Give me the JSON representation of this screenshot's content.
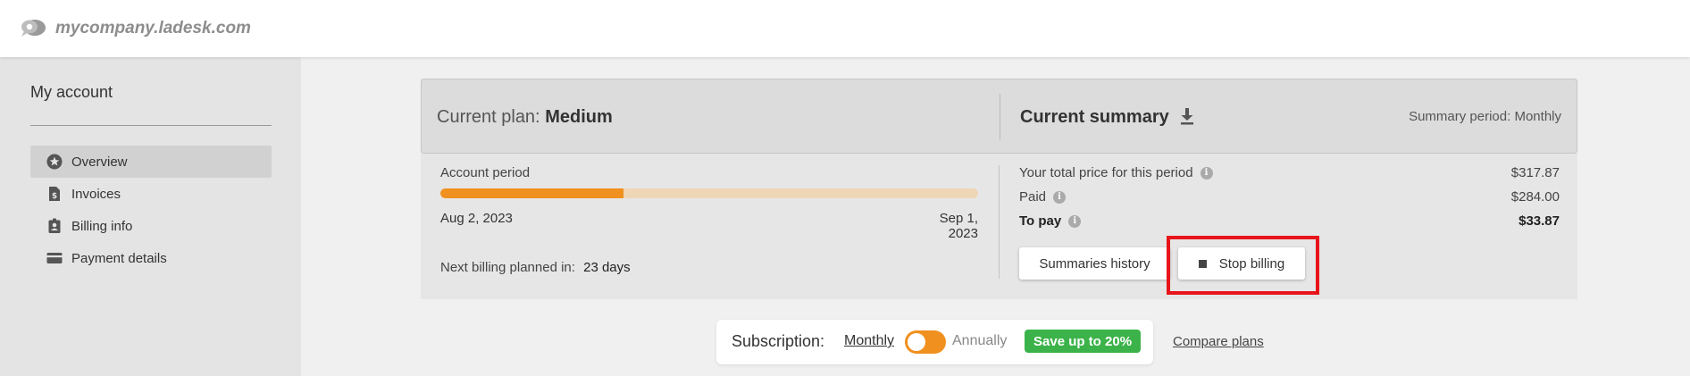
{
  "header": {
    "domain": "mycompany.ladesk.com"
  },
  "sidebar": {
    "title": "My account",
    "items": [
      {
        "label": "Overview",
        "icon": "star-badge-icon",
        "active": true
      },
      {
        "label": "Invoices",
        "icon": "invoice-dollar-icon",
        "active": false
      },
      {
        "label": "Billing info",
        "icon": "id-badge-icon",
        "active": false
      },
      {
        "label": "Payment details",
        "icon": "credit-card-icon",
        "active": false
      }
    ]
  },
  "plan": {
    "label": "Current plan:",
    "name": "Medium"
  },
  "summary": {
    "title": "Current summary",
    "period_label": "Summary period:",
    "period_value": "Monthly",
    "rows": [
      {
        "label": "Your total price for this period",
        "value": "$317.87"
      },
      {
        "label": "Paid",
        "value": "$284.00"
      },
      {
        "label": "To pay",
        "value": "$33.87"
      }
    ],
    "history_button": "Summaries history",
    "stop_button": "Stop billing"
  },
  "account": {
    "period_label": "Account period",
    "progress": 0.34,
    "start_date": "Aug 2, 2023",
    "end_date": "Sep 1, 2023",
    "next_billing_label": "Next billing planned in:",
    "next_billing_value": "23 days"
  },
  "subscription": {
    "label": "Subscription:",
    "monthly": "Monthly",
    "annually": "Annually",
    "save_badge": "Save up to 20%",
    "compare_link": "Compare plans"
  },
  "colors": {
    "accent": "#f0901e",
    "save_green": "#3cb34a",
    "highlight": "#e8141b"
  }
}
